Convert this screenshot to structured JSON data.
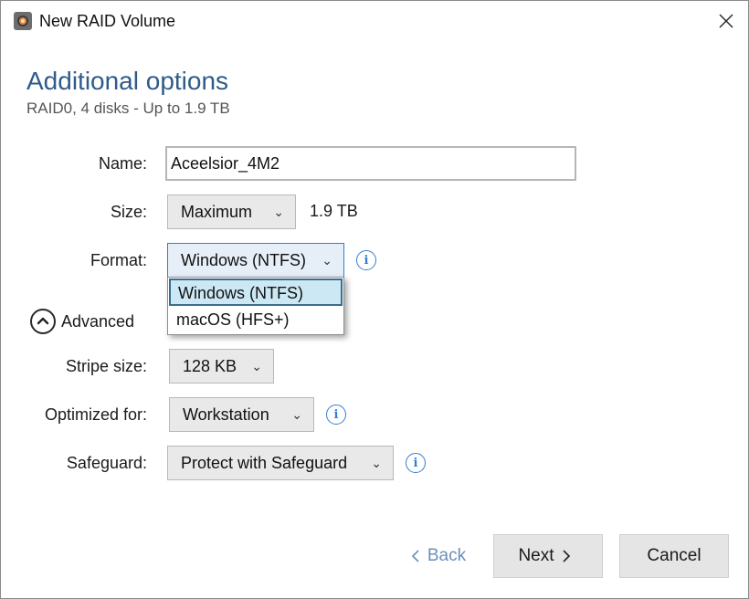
{
  "window": {
    "title": "New RAID Volume"
  },
  "page": {
    "heading": "Additional options",
    "subheading": "RAID0, 4 disks - Up to 1.9 TB"
  },
  "form": {
    "name_label": "Name:",
    "name_value": "Aceelsior_4M2",
    "size_label": "Size:",
    "size_value": "Maximum",
    "size_display": "1.9 TB",
    "format_label": "Format:",
    "format_value": "Windows (NTFS)",
    "format_options": [
      "Windows (NTFS)",
      "macOS (HFS+)"
    ],
    "advanced_label": "Advanced",
    "stripe_label": "Stripe size:",
    "stripe_value": "128 KB",
    "optimized_label": "Optimized for:",
    "optimized_value": "Workstation",
    "safeguard_label": "Safeguard:",
    "safeguard_value": "Protect with Safeguard"
  },
  "buttons": {
    "back": "Back",
    "next": "Next",
    "cancel": "Cancel"
  },
  "icons": {
    "app": "raid-disk-icon",
    "close": "close-icon",
    "info": "info-icon",
    "advanced_toggle": "chevron-up-circle-icon",
    "back": "chevron-left-icon",
    "next": "chevron-right-icon"
  },
  "colors": {
    "accent": "#2f7fd4",
    "heading": "#2f5b8b",
    "selection": "#cce8f4"
  }
}
